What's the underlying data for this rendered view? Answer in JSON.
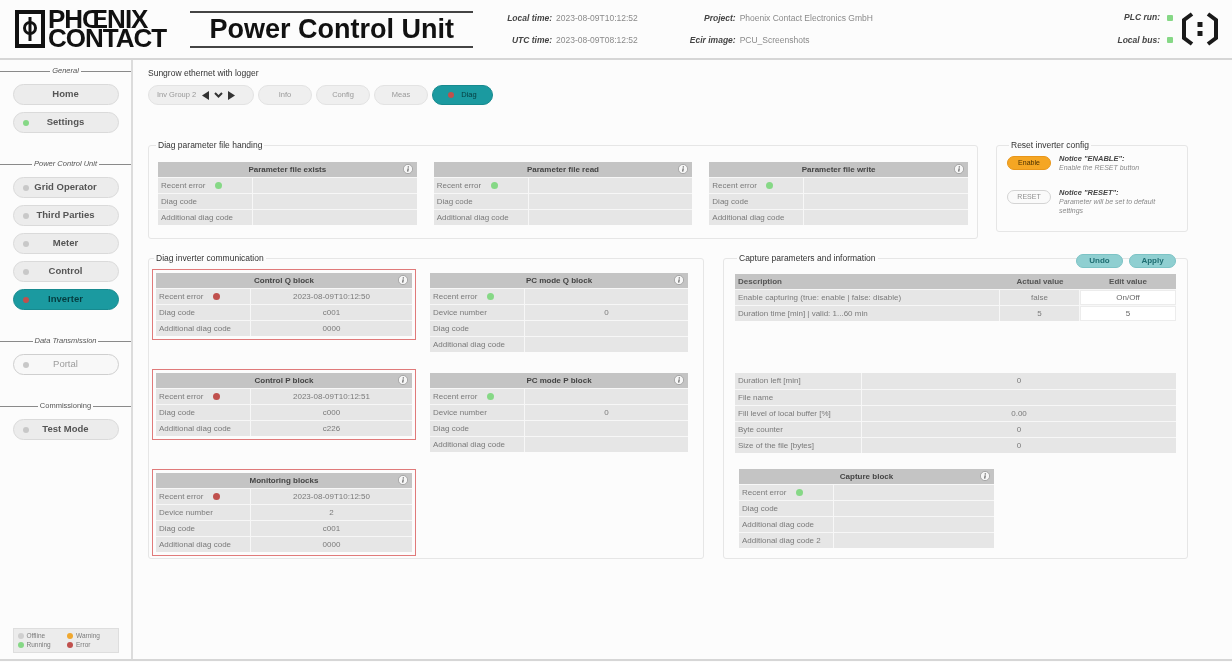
{
  "header": {
    "logo": {
      "lines": [
        "PHŒNIX",
        "CONTACT"
      ]
    },
    "title": "Power Control Unit",
    "times": [
      {
        "label": "Local time:",
        "value": "2023-08-09T10:12:52"
      },
      {
        "label": "UTC time:",
        "value": "2023-08-09T08:12:52"
      }
    ],
    "project": [
      {
        "label": "Project:",
        "value": "Phoenix Contact Electronics GmbH"
      },
      {
        "label": "Ecir image:",
        "value": "PCU_Screenshots"
      }
    ],
    "status": [
      {
        "label": "PLC run:",
        "color": "#86d886"
      },
      {
        "label": "Local bus:",
        "color": "#86d886"
      }
    ]
  },
  "sidebar": {
    "sections": [
      {
        "title": "General",
        "italic": true,
        "items": [
          {
            "label": "Home",
            "selected": false,
            "disabled": false
          },
          {
            "label": "Settings",
            "color": "#86d886",
            "selected": false,
            "disabled": false
          }
        ]
      },
      {
        "title": "Power Control Unit",
        "italic": true,
        "items": [
          {
            "label": "Grid Operator",
            "color": "#c8c8c8",
            "selected": false,
            "disabled": false
          },
          {
            "label": "Third Parties",
            "color": "#c8c8c8",
            "selected": false,
            "disabled": false
          },
          {
            "label": "Meter",
            "color": "#c8c8c8",
            "selected": false,
            "disabled": false
          },
          {
            "label": "Control",
            "color": "#c8c8c8",
            "selected": false,
            "disabled": false
          },
          {
            "label": "Inverter",
            "color": "#c0504d",
            "selected": true,
            "disabled": false
          }
        ]
      },
      {
        "title": "Data Transmission",
        "italic": true,
        "items": [
          {
            "label": "Portal",
            "color": "#c8c8c8",
            "selected": false,
            "disabled": true
          }
        ]
      },
      {
        "title": "Commissioning",
        "italic": false,
        "items": [
          {
            "label": "Test Mode",
            "color": "#c8c8c8",
            "selected": false,
            "disabled": false
          }
        ]
      }
    ],
    "legend": [
      {
        "label": "Offline",
        "color": "#cfcfcf"
      },
      {
        "label": "Warning",
        "color": "#f0a830"
      },
      {
        "label": "Running",
        "color": "#86d886"
      },
      {
        "label": "Error",
        "color": "#c0504d"
      }
    ]
  },
  "main": {
    "device": "Sungrow ethernet with logger",
    "group": {
      "label": "Inv Group 2"
    },
    "tabs": [
      {
        "label": "Info",
        "selected": false
      },
      {
        "label": "Config",
        "selected": false
      },
      {
        "label": "Meas",
        "selected": false
      },
      {
        "label": "Diag",
        "selected": true,
        "color": "#c0504d"
      }
    ],
    "param_file": {
      "title": "Diag parameter file handing",
      "blocks": [
        {
          "title": "Parameter file exists",
          "alert": false,
          "rows": [
            {
              "label": "Recent error",
              "color": "#86d886"
            },
            {
              "label": "Diag code"
            },
            {
              "label": "Additional diag code"
            }
          ]
        },
        {
          "title": "Parameter file read",
          "alert": false,
          "rows": [
            {
              "label": "Recent error",
              "color": "#86d886"
            },
            {
              "label": "Diag code"
            },
            {
              "label": "Additional diag code"
            }
          ]
        },
        {
          "title": "Parameter file write",
          "alert": false,
          "rows": [
            {
              "label": "Recent error",
              "color": "#86d886"
            },
            {
              "label": "Diag code"
            },
            {
              "label": "Additional diag code"
            }
          ]
        }
      ]
    },
    "reset": {
      "title": "Reset inverter config",
      "items": [
        {
          "button": "Enable",
          "enabled": true,
          "notice_title": "Notice \"ENABLE\":",
          "notice_text": "Enable the RESET button"
        },
        {
          "button": "RESET",
          "enabled": false,
          "notice_title": "Notice \"RESET\":",
          "notice_text": "Parameter will be set to default settings"
        }
      ]
    },
    "communication": {
      "title": "Diag inverter communication",
      "blocks": [
        {
          "title": "Control Q block",
          "alert": true,
          "rows": [
            {
              "label": "Recent error",
              "color": "#c0504d",
              "value": "2023-08-09T10:12:50"
            },
            {
              "label": "Diag code",
              "value": "c001"
            },
            {
              "label": "Additional diag code",
              "value": "0000"
            }
          ]
        },
        {
          "title": "PC mode Q block",
          "alert": false,
          "rows": [
            {
              "label": "Recent error",
              "color": "#86d886"
            },
            {
              "label": "Device number",
              "value": "0"
            },
            {
              "label": "Diag code"
            },
            {
              "label": "Additional diag code"
            }
          ]
        },
        {
          "title": "Control P block",
          "alert": true,
          "rows": [
            {
              "label": "Recent error",
              "color": "#c0504d",
              "value": "2023-08-09T10:12:51"
            },
            {
              "label": "Diag code",
              "value": "c000"
            },
            {
              "label": "Additional diag code",
              "value": "c226"
            }
          ]
        },
        {
          "title": "PC mode P block",
          "alert": false,
          "rows": [
            {
              "label": "Recent error",
              "color": "#86d886"
            },
            {
              "label": "Device number",
              "value": "0"
            },
            {
              "label": "Diag code"
            },
            {
              "label": "Additional diag code"
            }
          ]
        },
        {
          "title": "Monitoring blocks",
          "alert": true,
          "rows": [
            {
              "label": "Recent error",
              "color": "#c0504d",
              "value": "2023-08-09T10:12:50"
            },
            {
              "label": "Device number",
              "value": "2"
            },
            {
              "label": "Diag code",
              "value": "c001"
            },
            {
              "label": "Additional diag code",
              "value": "0000"
            }
          ]
        }
      ]
    },
    "capture": {
      "title": "Capture parameters and information",
      "buttons": [
        "Undo",
        "Apply"
      ],
      "table": {
        "columns": [
          "Description",
          "Actual value",
          "Edit value"
        ],
        "rows": [
          {
            "description": "Enable capturing (true: enable | false: disable)",
            "actual": "false",
            "edit": "On/Off"
          },
          {
            "description": "Duration time [min] | valid: 1...60 min",
            "actual": "5",
            "edit": "5"
          }
        ]
      },
      "info_rows": [
        {
          "label": "Duration left [min]",
          "value": "0"
        },
        {
          "label": "File name"
        },
        {
          "label": "Fill level of local buffer [%]",
          "value": "0.00"
        },
        {
          "label": "Byte counter",
          "value": "0"
        },
        {
          "label": "Size of the file [bytes]",
          "value": "0"
        }
      ],
      "block": {
        "title": "Capture block",
        "alert": false,
        "rows": [
          {
            "label": "Recent error",
            "color": "#86d886"
          },
          {
            "label": "Diag code"
          },
          {
            "label": "Additional diag code"
          },
          {
            "label": "Additional diag code 2"
          }
        ]
      }
    }
  }
}
